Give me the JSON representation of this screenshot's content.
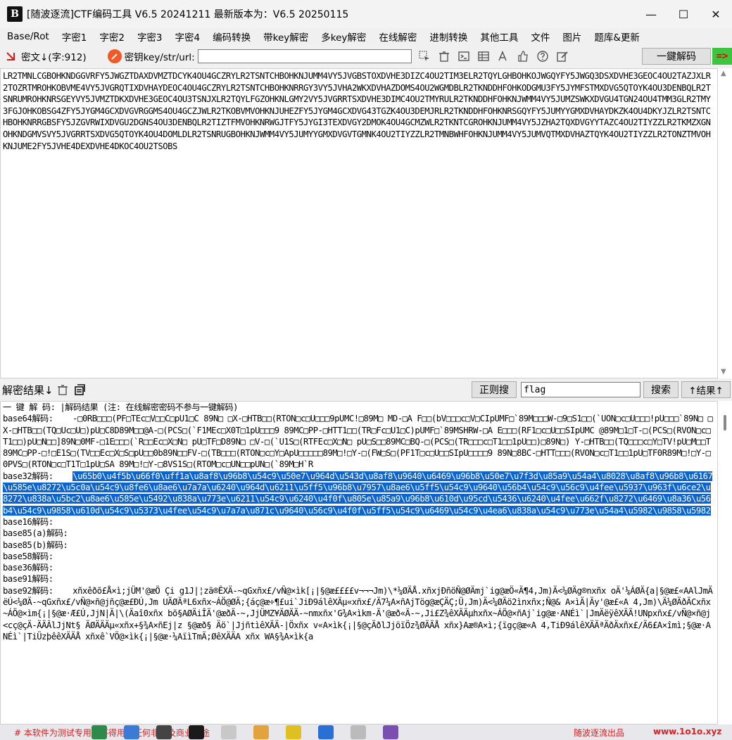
{
  "window": {
    "title": "[随波逐流]CTF编码工具 V6.5 20241211    最新版本为：V6.5 20250115",
    "logo_text": "B",
    "minimize": "—",
    "maximize": "☐",
    "close": "✕"
  },
  "menu": [
    "Base/Rot",
    "字密1",
    "字密2",
    "字密3",
    "字密4",
    "编码转换",
    "带key解密",
    "多key解密",
    "在线解密",
    "进制转换",
    "其他工具",
    "文件",
    "图片",
    "题库&更新"
  ],
  "toolbar": {
    "cipher_label": "密文↓(字:912)",
    "key_label": "密钥key/str/url:",
    "key_value": "",
    "decode_all": "一鍵解码",
    "arrow": "=>"
  },
  "cipher_text": "LR2TMNLCGBOHKNDGGVRFY5JWGZTDAXDVMZTDCYK4OU4GCZRYLR2TSNTCHBOHKNJUMM4VY5JVGBSTOXDVHE3DIZC4OU2TIM3ELR2TQYLGHBOHKOJWGQYFY5JWGQ3DSXDVHE3GEOC4OU2TAZJXLR2TOZRTMROHKOBVME4VY5JVGRQTIXDVHAYDEOC4OU4GCZRYLR2TSNTCHBOHKNRRGY3VY5JVHA2WKXDVHAZDOMS4OU2WGMDBLR2TKNDDHFOHKODGMU3FY5JYMFSTMXDVG5QTOYK4OU3DENBQLR2TSNRUMROHKNRSGEYVY5JVMZTDKXDVHE3GEOC4OU3TSNJXLR2TQYLFGZOHKNLGMY2VY5JVGRRTSXDVHE3DIMC4OU2TMYRULR2TKNDDHFOHKNJWMM4VY5JUMZSWKXDVGU4TGN24OU4TMM3GLR2TMY3FGJOHKOBSG4ZFY5JYGM4GCXDVGVRGGMS4OU4GCZJWLR2TKOBVMVOHKNJUHEZFY5JYGM4GCXDVG43TGZK4OU3DEMJRLR2TKNDDHFOHKNRSGQYFY5JUMYYGMXDVHAYDKZK4OU4DKYJZLR2TSNTCHBOHKNRRGBSFY5JZGVRWIXDVGU2DGNS4OU3DENBQLR2TIZTFMVOHKNRWGJTFY5JYGI3TEXDVGY2DMOK4OU4GCMZWLR2TKNTCGROHKNJUMM4VY5JZHA2TQXDVGYYTAZC4OU2TIYZZLR2TKMZXGNOHKNDGMVSVY5JVGRRTSXDVG5QTOYK4OU4DOMLDLR2TSNRUGBOHKNJWMM4VY5JUMYYGMXDVGVTGMNK4OU2TIYZZLR2TMNBWHFOHKNJUMM4VY5JUMVQTMXDVHAZTQYK4OU2TIYZZLR2TONZTMVOHKNJUME2FY5JVHE4DEXDVHE4DKOC4OU2TSOBS",
  "result_bar": {
    "label": "解密结果↓",
    "regex_btn": "正则搜",
    "search_value": "flag",
    "search_btn": "搜索",
    "result_up_btn": "↑结果↑"
  },
  "results": {
    "header": "一 键 解 码:    |解码结果 (注: 在线解密密码不参与一键解码)",
    "base64_label": "base64解码:",
    "base64_value": "-□0RB□□□(PF□TEc□V□□C□pU1□C  89N□  □X-□HTB□□(RTON□c□U□□□9pUMC!□89M□  MD-□A F□□(bV□□□c□V□CIpUMF□`89M□□□W-□9□S1□□(`UON□c□U□□□!pU□□□`89N□  □X-□HTB□□(TQ□Uc□U□)pU□C8D89M□□@A-□(PCS□(`F1MEc□X0T□1pU□□□9 89MC□PP-□HTT1□□(TR□Fc□U1□C)pUMF□`89MSHRW-□A E□□□(RF1□c□U□□SIpUMC @89M□1□T-□(PCS□(RVON□c□T1□□)pU□N□□]89N□0MF-□1E□□□(`R□□Ec□X□N□  pU□TF□D89N□  □V-□(`U1S□(RTFEc□X□N□     pU□S□□89MC□BQ-□(PCS□(TR□□□c□T1□□1pU□□)□89N□) Y-□HTB□□(TQ□□□c□Y□TV!pU□M□□T89MC□PP-□!□E1S□(TV□□Ec□X□S□pU□□0b89N□□FV-□(TB□□□(RTON□c□Y□ApU□□□□□89M□!□Y-□(FW□S□(PF1T□c□U□□SIpU□□□□9 89N□8BC-□HTT□□□(RVON□c□T1□□1pU□TF0R89M□!□Y-□0PVS□(RTON□c□T1T□1pU□SA 89M□!□Y-□8VS1S□(RTOM□c□UN□□pUN□(`89M□H`R",
    "base32_label": "base32解码:",
    "base32_value": "\\u65b0\\u4f5b\\u66f0\\uff1a\\u8af8\\u96b8\\u54c9\\u50e7\\u964d\\u543d\\u8af8\\u9640\\u6469\\u96b8\\u50e7\\u7f3d\\u85a9\\u54a4\\u8028\\u8af8\\u96b8\\u6167\\u585e\\u8272\\u5c0a\\u54c9\\u8fe6\\u8ae6\\u7a7a\\u6240\\u964d\\u6211\\u5ff5\\u96b8\\u7957\\u8ae6\\u5ff5\\u54c9\\u9640\\u56b4\\u54c9\\u56c9\\u4fee\\u5937\\u963f\\u6ce2\\u8272\\u838a\\u5bc2\\u8ae6\\u585e\\u5492\\u838a\\u773e\\u6211\\u54c9\\u6240\\u4f0f\\u805e\\u85a9\\u96b8\\u610d\\u95cd\\u5436\\u6240\\u4fee\\u662f\\u8272\\u6469\\u8a36\\u56b4\\u54c9\\u9858\\u610d\\u54c9\\u5373\\u4fee\\u54c9\\u7a7a\\u871c\\u9640\\u56c9\\u4f0f\\u5ff5\\u54c9\\u6469\\u54c9\\u4ea6\\u838a\\u54c9\\u773e\\u54a4\\u5982\\u9858\\u5982",
    "base16_label": "base16解码:",
    "base85a_label": "base85(a)解码:",
    "base85b_label": "base85(b)解码:",
    "base58_label": "base58解码:",
    "base36_label": "base36解码:",
    "base91_label": "base91解码:",
    "base92_label": "base92解码:",
    "base92_value": "xñxêðõ£Å×ì;jÜM'@æÖ Çi g1J|¦zä®ÊXÄ-~qGxñx£/vÑ@×ìk[¡|§@æ££££v¬¬¬Jm)\\*¼ØÄÅ.xñxjÐñöÑ@ØÄmj`ig@æÖ«Ä¶4,Jm)Ä<¼ØÄg®nxñx  oÄ'¼ÁØÄ{a|§@æ£«AAlJmÄëÚ<¼ØÄ-~qGxñx£/vÑ@×ñ@jñç@æ£ÐÚ,Jm   UÄØÄªL6xñx~ÁÖ@ØÄ;{áç@æ÷¶£ui`JiÐ9álêXÄµ«xñx£/Ä7¼A×ñAjTög@æÇÄÇ;Ü,Jm)Ä<¼ØÄö2ìnxñx;Ñ@& A×ìÄ|Äy'@æ£«A 4,Jm)\\Ä¼ØÄðÄCxñx~ÁÖ@×ìm{¡|§@æ·Æ£Ú,JjN|Ä|\\(Äaî0xñx bõ§AØÄiÎÄ'@æðÄ-~,JjÜMZ¥ÄØÄÄ-~nmxñx'G¾A×ìkm-Ä'@æð«Ä-~,Ji£Z¾êXÄÄµhxñx~ÁÖ@×ñAj`ig@æ·ANÉì`|JmÄëÿêXÄÄ!UNpxñx£/vÑ@×ñ@j<cç@çÄ-ÄÄÂlJjNt§ ÄØÄÄÄµ«xñx+§¾A×ñEj|z §@æð§ Äö`|JjñtìêXÄÄ-|Öxñx v«A×ìk{¡|§@çÄðlJjöïÖz¾ØÄÄÅ xñx}Aæ®A×ì;{ïgç@æ«A 4,TiÐ9álêXÄÄªÄðÄxñx£/Ä6£A×îmì;§@æ·ANÉì`|TiÜzþêêXÄÄÅ xñxê`VÖ@×ìk{¡|§@æ·¼AïìTmÄ;ØêXÄÄA xñx  WA§¾A×ìk{a"
  },
  "status": {
    "left": "# 本软件为测试专用，不得用于任何非法及商业用途",
    "right": "随波逐流出品",
    "url": "www.1o1o.xyz"
  }
}
